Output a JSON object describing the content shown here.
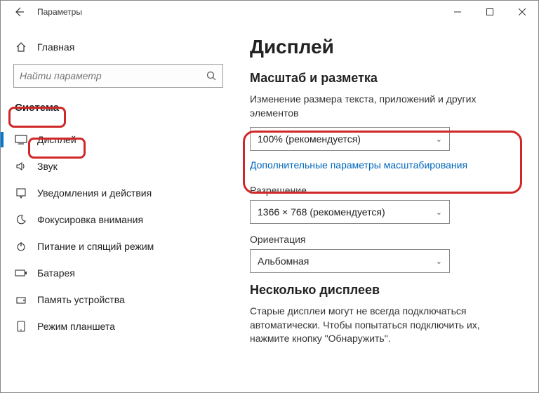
{
  "titlebar": {
    "title": "Параметры"
  },
  "sidebar": {
    "home": "Главная",
    "search_placeholder": "Найти параметр",
    "section": "Система",
    "items": [
      {
        "label": "Дисплей"
      },
      {
        "label": "Звук"
      },
      {
        "label": "Уведомления и действия"
      },
      {
        "label": "Фокусировка внимания"
      },
      {
        "label": "Питание и спящий режим"
      },
      {
        "label": "Батарея"
      },
      {
        "label": "Память устройства"
      },
      {
        "label": "Режим планшета"
      }
    ]
  },
  "content": {
    "title": "Дисплей",
    "scale_heading": "Масштаб и разметка",
    "scale_desc": "Изменение размера текста, приложений и других элементов",
    "scale_value": "100% (рекомендуется)",
    "scale_link": "Дополнительные параметры масштабирования",
    "res_label": "Разрешение",
    "res_value": "1366 × 768 (рекомендуется)",
    "orient_label": "Ориентация",
    "orient_value": "Альбомная",
    "multi_heading": "Несколько дисплеев",
    "multi_desc": "Старые дисплеи могут не всегда подключаться автоматически. Чтобы попытаться подключить их, нажмите кнопку \"Обнаружить\"."
  }
}
